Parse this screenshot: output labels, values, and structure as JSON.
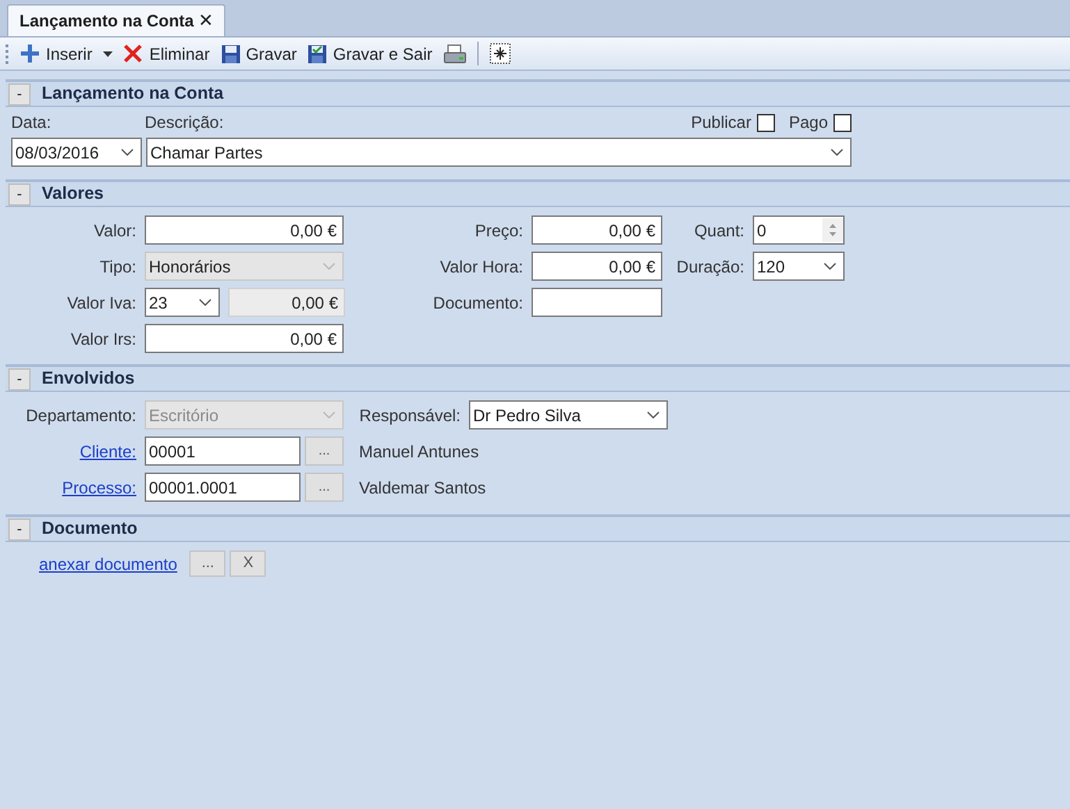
{
  "tab": {
    "label": "Lançamento na Conta",
    "close": "✕",
    "selected": true
  },
  "toolbar": [
    {
      "kind": "insert",
      "label": "Inserir"
    },
    {
      "kind": "delete",
      "label": "Eliminar"
    },
    {
      "kind": "save",
      "label": "Gravar"
    },
    {
      "kind": "save-exit",
      "label": "Gravar e Sair"
    },
    {
      "kind": "print"
    },
    {
      "kind": "separator"
    },
    {
      "kind": "layout"
    }
  ],
  "header": {
    "toggle": "-",
    "title": "Lançamento na Conta",
    "date": {
      "label": "Data:",
      "value": "08/03/2016"
    },
    "description": {
      "label": "Descrição:",
      "value": "Chamar Partes"
    },
    "checks": [
      {
        "label": "Publicar",
        "checked": false
      },
      {
        "label": "Pago",
        "checked": false
      }
    ]
  },
  "valores": {
    "toggle": "-",
    "title": "Valores",
    "columns": [
      [
        {
          "kind": "amount",
          "label": "Valor:",
          "value": "0,00 €"
        },
        {
          "kind": "combo",
          "label": "Tipo:",
          "value": "Honorários",
          "disabled": true
        },
        {
          "kind": "combo-amount",
          "label": "Valor Iva:",
          "value": "23",
          "amount": "0,00 €"
        },
        {
          "kind": "amount",
          "label": "Valor Irs:",
          "value": "0,00 €"
        }
      ],
      [
        {
          "kind": "amount",
          "label": "Preço:",
          "value": "0,00 €"
        },
        {
          "kind": "amount",
          "label": "Valor Hora:",
          "value": "0,00 €"
        },
        {
          "kind": "text",
          "label": "Documento:"
        }
      ],
      [
        {
          "kind": "spin",
          "label": "Quant:",
          "value": "0"
        },
        {
          "kind": "combo",
          "label": "Duração:",
          "value": "120",
          "disabled": false
        }
      ]
    ]
  },
  "envolvidos": {
    "toggle": "-",
    "title": "Envolvidos",
    "departamento": {
      "label": "Departamento:",
      "value": "Escritório",
      "disabled": true
    },
    "responsavel": {
      "label": "Responsável:",
      "value": "Dr Pedro Silva",
      "disabled": false
    },
    "lookups": [
      {
        "label": "Cliente:",
        "value": "00001",
        "button": "...",
        "name": "Manuel Antunes"
      },
      {
        "label": "Processo:",
        "value": "00001.0001",
        "button": "...",
        "name": "Valdemar Santos"
      }
    ]
  },
  "documento": {
    "toggle": "-",
    "title": "Documento",
    "link": "anexar documento",
    "buttons": [
      "...",
      "X"
    ]
  }
}
